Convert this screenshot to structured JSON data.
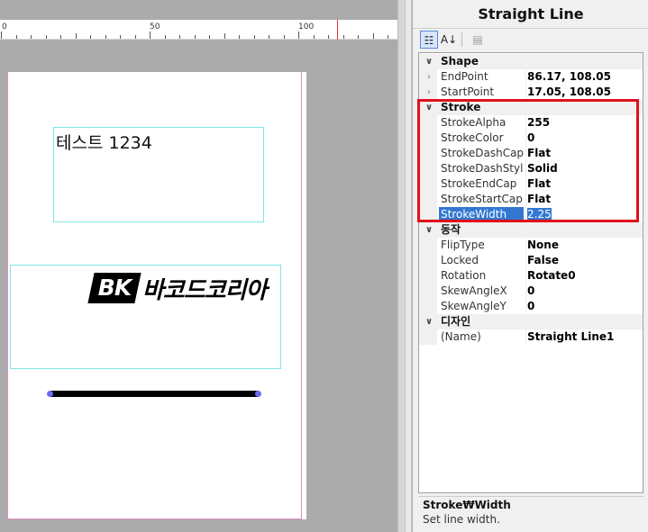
{
  "ruler": {
    "labels": [
      "0",
      "50",
      "100"
    ]
  },
  "canvas": {
    "text_object": "테스트 1234",
    "barcode_logo": "BK",
    "barcode_name": "바코드코리아"
  },
  "panel": {
    "title": "Straight Line",
    "toolbar": {
      "categorized_icon": "categorized-icon",
      "alphabetical_icon": "sort-az-icon",
      "pages_icon": "property-pages-icon"
    },
    "categories": [
      {
        "name": "Shape",
        "properties": [
          {
            "name": "EndPoint",
            "value": "86.17, 108.05",
            "expandable": true
          },
          {
            "name": "StartPoint",
            "value": "17.05, 108.05",
            "expandable": true
          }
        ]
      },
      {
        "name": "Stroke",
        "properties": [
          {
            "name": "StrokeAlpha",
            "value": "255"
          },
          {
            "name": "StrokeColor",
            "value": "0"
          },
          {
            "name": "StrokeDashCap",
            "value": "Flat"
          },
          {
            "name": "StrokeDashStyle",
            "value": "Solid"
          },
          {
            "name": "StrokeEndCap",
            "value": "Flat"
          },
          {
            "name": "StrokeStartCap",
            "value": "Flat"
          },
          {
            "name": "StrokeWidth",
            "value": "2.25",
            "selected": true
          }
        ]
      },
      {
        "name": "동작",
        "properties": [
          {
            "name": "FlipType",
            "value": "None"
          },
          {
            "name": "Locked",
            "value": "False"
          },
          {
            "name": "Rotation",
            "value": "Rotate0"
          },
          {
            "name": "SkewAngleX",
            "value": "0"
          },
          {
            "name": "SkewAngleY",
            "value": "0"
          }
        ]
      },
      {
        "name": "디자인",
        "properties": [
          {
            "name": "(Name)",
            "value": "Straight Line1"
          }
        ]
      }
    ],
    "description": {
      "title": "Stroke₩Width",
      "text": "Set line width."
    }
  },
  "colors": {
    "highlight": "#e0101a",
    "selection": "#3278d2",
    "handle": "#6c6cf0"
  }
}
